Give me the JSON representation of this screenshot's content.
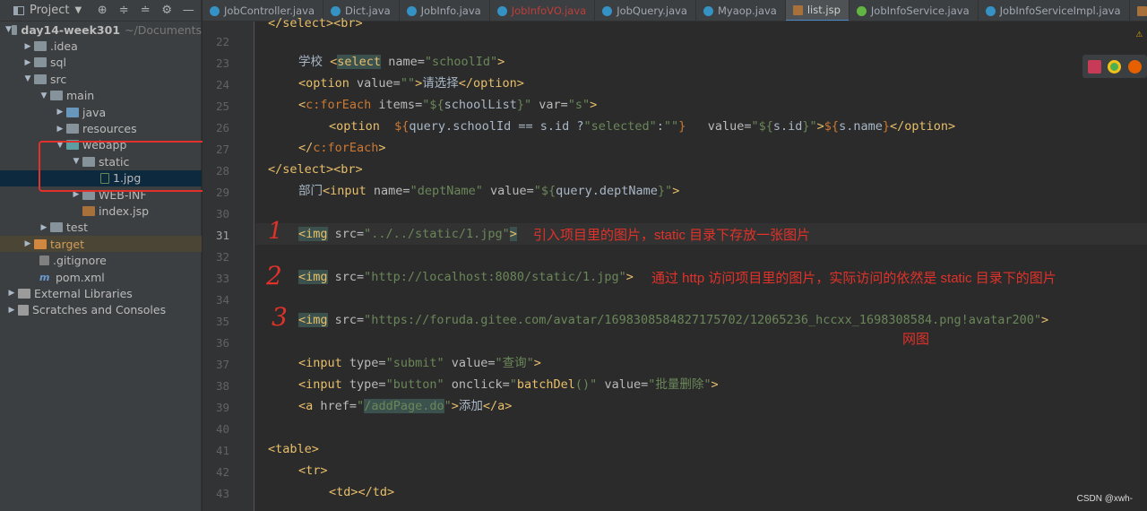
{
  "project_panel": {
    "title": "Project",
    "tree": [
      {
        "label": "day14-week301",
        "hint": "~/Documents"
      },
      {
        "label": ".idea"
      },
      {
        "label": "sql"
      },
      {
        "label": "src"
      },
      {
        "label": "main"
      },
      {
        "label": "java"
      },
      {
        "label": "resources"
      },
      {
        "label": "webapp"
      },
      {
        "label": "static"
      },
      {
        "label": "1.jpg"
      },
      {
        "label": "WEB-INF"
      },
      {
        "label": "index.jsp"
      },
      {
        "label": "test"
      },
      {
        "label": "target"
      },
      {
        "label": ".gitignore"
      },
      {
        "label": "pom.xml"
      },
      {
        "label": "External Libraries"
      },
      {
        "label": "Scratches and Consoles"
      }
    ],
    "pom_glyph": "m"
  },
  "tabs": [
    {
      "label": "JobController.java"
    },
    {
      "label": "Dict.java"
    },
    {
      "label": "JobInfo.java"
    },
    {
      "label": "JobInfoVO.java"
    },
    {
      "label": "JobQuery.java"
    },
    {
      "label": "Myaop.java"
    },
    {
      "label": "list.jsp"
    },
    {
      "label": "JobInfoService.java"
    },
    {
      "label": "JobInfoServiceImpl.java"
    },
    {
      "label": "ap"
    }
  ],
  "line_numbers": [
    "22",
    "23",
    "24",
    "25",
    "26",
    "27",
    "28",
    "29",
    "30",
    "31",
    "32",
    "33",
    "34",
    "35",
    "36",
    "37",
    "38",
    "39",
    "40",
    "41",
    "42",
    "43"
  ],
  "code": {
    "l22": "</select><br>",
    "l23a": "学校 ",
    "l23b": "<",
    "l23c": "select",
    "l23d": " name=",
    "l23e": "\"schoolId\"",
    "l23f": ">",
    "l24a": "<option",
    "l24b": " value=",
    "l24c": "\"\"",
    "l24d": ">",
    "l24e": "请选择",
    "l24f": "</option>",
    "l25a": "<",
    "l25b": "c:forEach",
    "l25c": " items=",
    "l25d": "\"${",
    "l25e": "schoolList",
    "l25f": "}\"",
    "l25g": " var=",
    "l25h": "\"s\"",
    "l25i": ">",
    "l26a": "<option  ",
    "l26b": "${",
    "l26c": "query.schoolId == s.id ?",
    "l26d": "\"selected\"",
    "l26e": ":",
    "l26f": "\"\"",
    "l26g": "}",
    "l26h": "   value=",
    "l26i": "\"${",
    "l26j": "s.id",
    "l26k": "}\"",
    "l26l": ">",
    "l26m": "${",
    "l26n": "s.name",
    "l26o": "}",
    "l26p": "</option>",
    "l27a": "</",
    "l27b": "c:forEach",
    "l27c": ">",
    "l28": "</select><br>",
    "l29a": "部门",
    "l29b": "<input",
    "l29c": " name=",
    "l29d": "\"deptName\"",
    "l29e": " value=",
    "l29f": "\"${",
    "l29g": "query.deptName",
    "l29h": "}\"",
    "l29i": ">",
    "l31a": "<img",
    "l31b": " src=",
    "l31c": "\"../../static/1.jpg\"",
    "l31d": ">",
    "l33a": "<img",
    "l33b": " src=",
    "l33c": "\"http://localhost:8080/static/1.jpg\"",
    "l33d": ">",
    "l35a": "<img",
    "l35b": " src=",
    "l35c": "\"https://foruda.gitee.com/avatar/1698308584827175702/12065236_hccxx_1698308584.png!avatar200\"",
    "l35d": ">",
    "l37a": "<input",
    "l37b": " type=",
    "l37c": "\"submit\"",
    "l37d": " value=",
    "l37e": "\"查询\"",
    "l37f": ">",
    "l38a": "<input",
    "l38b": " type=",
    "l38c": "\"button\"",
    "l38d": " onclick=",
    "l38e": "\"",
    "l38f": "batchDel",
    "l38g": "()\"",
    "l38h": " value=",
    "l38i": "\"批量删除\"",
    "l38j": ">",
    "l39a": "<a",
    "l39b": " href=",
    "l39c": "\"",
    "l39d": "/addPage.do",
    "l39e": "\"",
    "l39f": ">",
    "l39g": "添加",
    "l39h": "</a>",
    "l41": "<table>",
    "l42": "<tr>",
    "l43": "<td></td>"
  },
  "annotations": {
    "mark1": "1",
    "note1": "引入项目里的图片，static 目录下存放一张图片",
    "mark2": "2",
    "note2": "通过 http 访问项目里的图片，实际访问的依然是 static 目录下的图片",
    "mark3": "3",
    "note3": "网图"
  },
  "warning_icon": "⚠",
  "watermark": "CSDN @xwh-",
  "colors": {
    "tag": "#e8bf6a",
    "attr": "#bababa",
    "string": "#6a8759",
    "keyword": "#cc7832",
    "annotation_red": "#e0322a"
  }
}
